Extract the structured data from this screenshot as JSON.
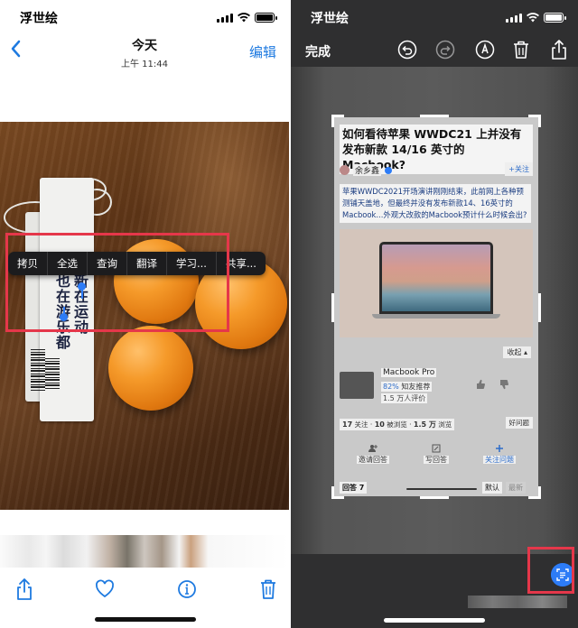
{
  "left": {
    "status": {
      "carrier": "浮世绘"
    },
    "nav": {
      "title": "今天",
      "subtitle": "上午 11:44",
      "edit": "编辑"
    },
    "photo": {
      "tag_text_1": "新在运动",
      "tag_text_2": "也在游乐都"
    },
    "context_menu": [
      "拷贝",
      "全选",
      "查询",
      "翻译",
      "学习...",
      "共享..."
    ],
    "toolbar": {
      "icons": [
        "share-icon",
        "heart-icon",
        "info-icon",
        "trash-icon"
      ]
    }
  },
  "right": {
    "status": {
      "carrier": "浮世绘"
    },
    "toolbar": {
      "done": "完成",
      "icons": [
        "undo-icon",
        "redo-icon",
        "markup-pen-icon",
        "trash-icon",
        "share-icon"
      ]
    },
    "doc": {
      "title": "如何看待苹果 WWDC21 上并没有发布新款 14/16 英寸的 Macbook?",
      "author": "余乡鑫",
      "follow": "+关注",
      "paragraph": "苹果WWDC2021开场演讲刚刚结束，此前网上各种预测铺天盖地，但最终并没有发布新款14、16英寸的Macbook...外观大改款的Macbook预计什么时候会出?",
      "collapse": "收起 ▴",
      "product": {
        "name": "Macbook Pro",
        "rate_value": "82%",
        "rate_label": "知友推荐",
        "count": "1.5 万人评价"
      },
      "stats": {
        "a": "17",
        "a_label": "关注",
        "b": "10",
        "b_label": "被浏览",
        "c": "1.5 万",
        "c_label": "浏览"
      },
      "good_question": "好问题",
      "actions": [
        "邀请回答",
        "写回答",
        "关注问题"
      ],
      "answers": {
        "count": "回答 7",
        "default": "默认",
        "latest": "最新"
      }
    }
  },
  "colors": {
    "ios_blue": "#1e7ae0",
    "highlight_red": "#e5374a",
    "live_text_blue": "#2d7cf6"
  }
}
